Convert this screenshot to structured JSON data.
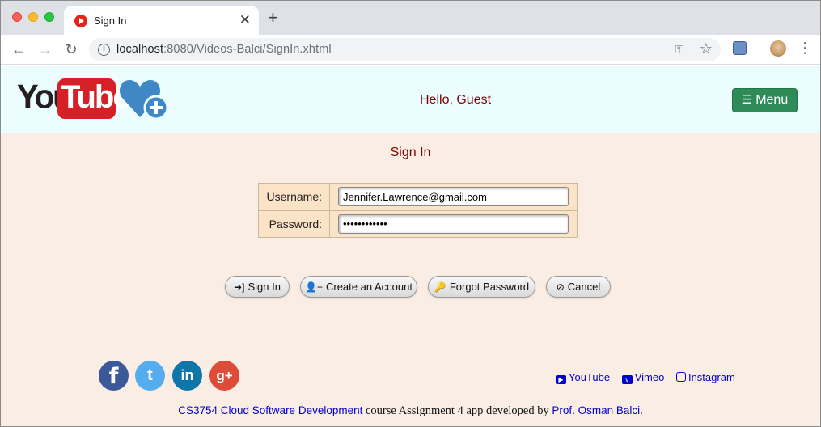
{
  "browser": {
    "tab_title": "Sign In",
    "url_host": "localhost",
    "url_rest": ":8080/Videos-Balci/SignIn.xhtml"
  },
  "header": {
    "logo_you": "You",
    "logo_tube": "Tube",
    "greeting": "Hello, Guest",
    "menu_label": "Menu"
  },
  "signin": {
    "title": "Sign In",
    "username_label": "Username:",
    "username_value": "Jennifer.Lawrence@gmail.com",
    "password_label": "Password:",
    "password_value": "••••••••••••"
  },
  "buttons": {
    "signin": "Sign In",
    "create": "Create an Account",
    "forgot": "Forgot Password",
    "cancel": "Cancel"
  },
  "social": {
    "facebook": "f",
    "twitter": "t",
    "linkedin": "in",
    "googleplus": "g+"
  },
  "links": {
    "youtube": "YouTube",
    "vimeo": "Vimeo",
    "instagram": "Instagram"
  },
  "footer": {
    "course_link": "CS3754 Cloud Software Development",
    "middle_text": " course Assignment 4 app developed by ",
    "author_link": "Prof. Osman Balci",
    "end": "."
  }
}
